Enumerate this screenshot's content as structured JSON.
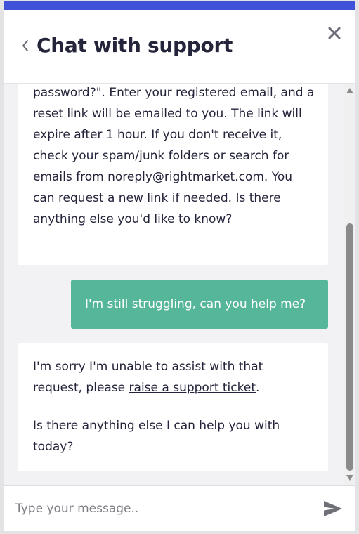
{
  "header": {
    "title": "Chat with support",
    "back_icon": "chevron-left-icon",
    "close_icon": "close-icon"
  },
  "colors": {
    "accent_bar": "#3f51d8",
    "user_bubble": "#55b699",
    "message_area_background": "#f2f2f4",
    "title_text": "#24243a"
  },
  "messages": [
    {
      "sender": "support",
      "text": "password?\". Enter your registered email, and a reset link will be emailed to you. The link will expire after 1 hour. If you don't receive it, check your spam/junk folders or search for emails from noreply@rightmarket.com. You can request a new link if needed. Is there anything else you'd like to know?"
    },
    {
      "sender": "user",
      "text": "I'm still struggling, can you help me?"
    },
    {
      "sender": "support",
      "text_before_link": "I'm sorry I'm unable to assist with that request, please ",
      "link_text": "raise a support ticket",
      "text_after_link": ".",
      "followup": "Is there anything else I can help you with today?"
    }
  ],
  "composer": {
    "placeholder": "Type your message..",
    "value": "",
    "send_icon": "send-icon"
  }
}
